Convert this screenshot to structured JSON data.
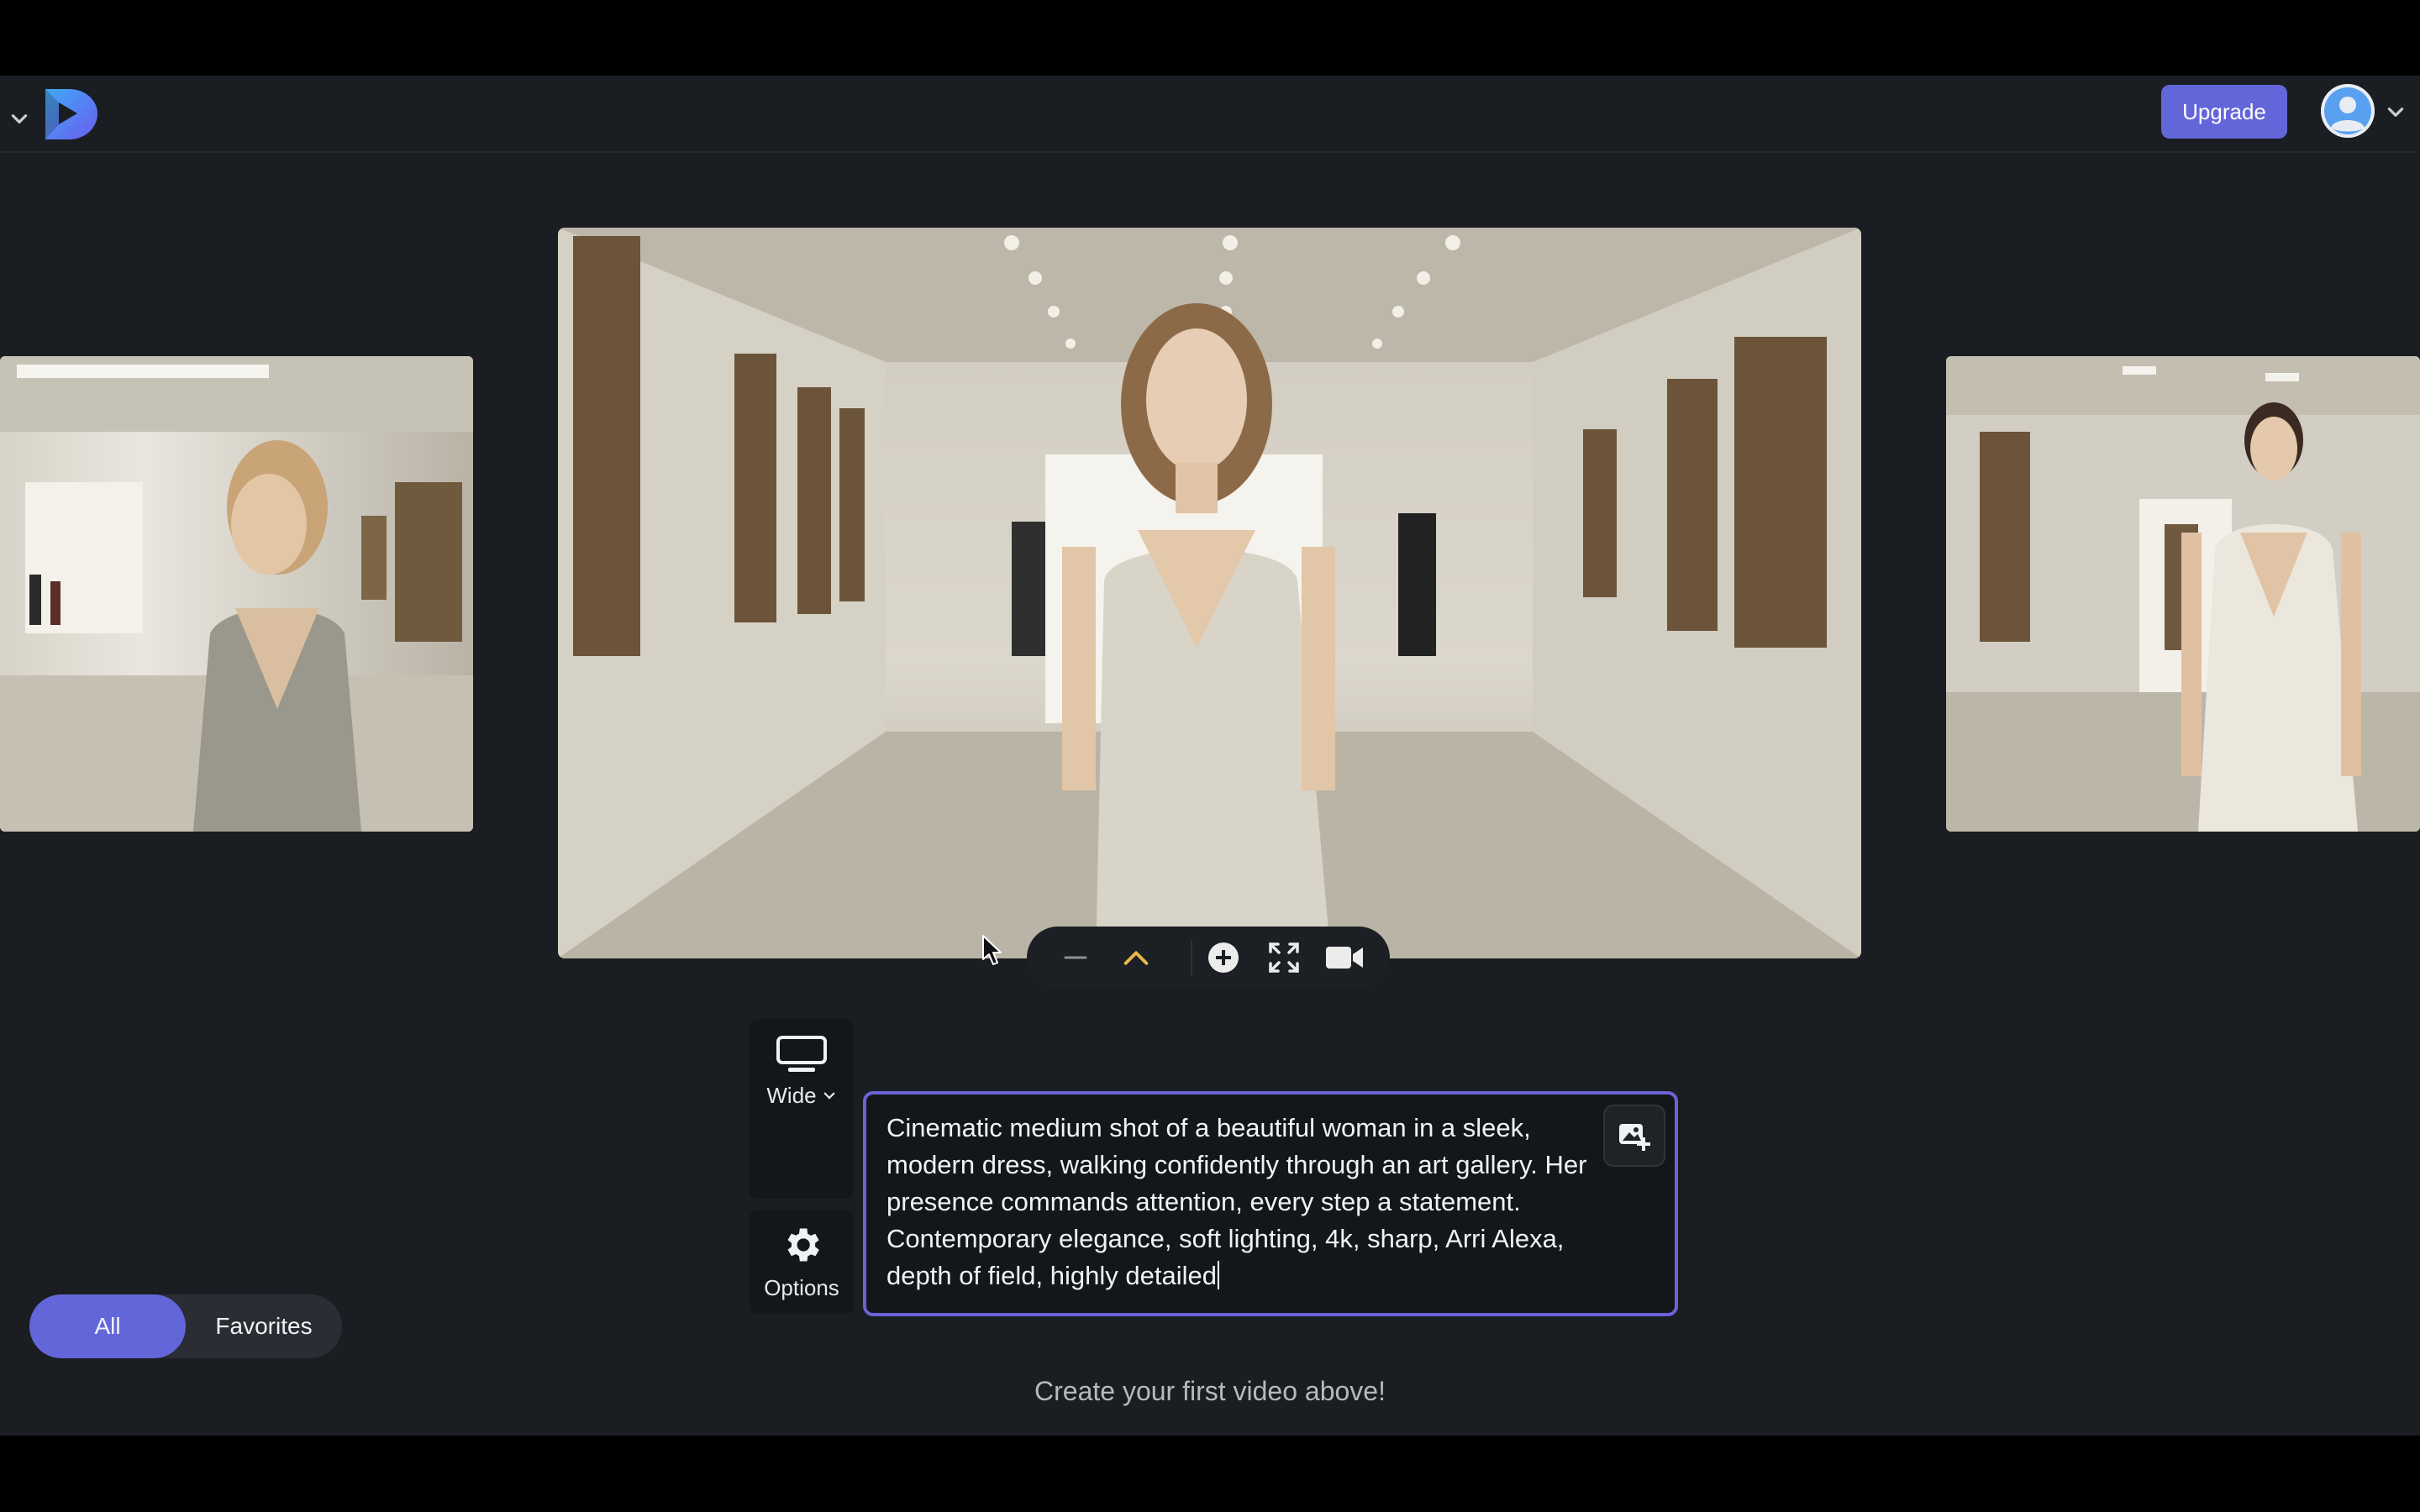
{
  "header": {
    "upgrade_label": "Upgrade"
  },
  "player_controls": {
    "icons": [
      "minus-icon",
      "chevron-up-icon",
      "plus-circle-icon",
      "expand-icon",
      "video-camera-icon"
    ]
  },
  "aspect": {
    "label": "Wide"
  },
  "options": {
    "label": "Options"
  },
  "prompt": {
    "text": "Cinematic medium shot of a beautiful woman in a sleek, modern dress, walking confidently through an art gallery. Her presence commands attention, every step a statement. Contemporary elegance, soft lighting, 4k, sharp, Arri Alexa, depth of field, highly detailed"
  },
  "filters": {
    "all_label": "All",
    "favorites_label": "Favorites",
    "active": "All"
  },
  "empty_state": {
    "message": "Create your first video above!"
  },
  "colors": {
    "accent": "#6366d9",
    "prompt_border": "#6b63d6",
    "background": "#1a1d21",
    "control_highlight": "#e6b84a"
  }
}
